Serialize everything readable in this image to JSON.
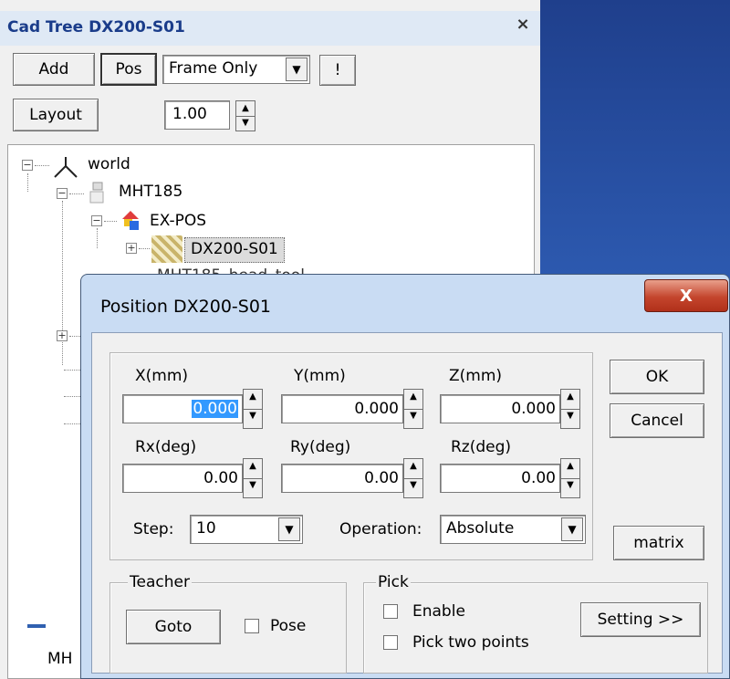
{
  "cad_tree": {
    "title": "Cad Tree DX200-S01",
    "close_glyph": "×",
    "add_label": "Add",
    "pos_label": "Pos",
    "frame_select_value": "Frame Only",
    "bang_label": "!",
    "layout_label": "Layout",
    "scale_value": "1.00",
    "nodes": {
      "world": "world",
      "mht185": "MHT185",
      "expos": "EX-POS",
      "dx200": "DX200-S01",
      "partial_sibling": "MHT185_head_tool",
      "bottom_label": "MH"
    }
  },
  "dialog": {
    "title": "Position DX200-S01",
    "close_glyph": "X",
    "fields": {
      "x_label": "X(mm)",
      "x_value": "0.000",
      "y_label": "Y(mm)",
      "y_value": "0.000",
      "z_label": "Z(mm)",
      "z_value": "0.000",
      "rx_label": "Rx(deg)",
      "rx_value": "0.00",
      "ry_label": "Ry(deg)",
      "ry_value": "0.00",
      "rz_label": "Rz(deg)",
      "rz_value": "0.00"
    },
    "step_label": "Step:",
    "step_value": "10",
    "operation_label": "Operation:",
    "operation_value": "Absolute",
    "ok_label": "OK",
    "cancel_label": "Cancel",
    "matrix_label": "matrix",
    "teacher": {
      "group_label": "Teacher",
      "goto_label": "Goto",
      "pose_label": "Pose"
    },
    "pick": {
      "group_label": "Pick",
      "enable_label": "Enable",
      "two_points_label": "Pick two points",
      "setting_label": "Setting >>"
    }
  },
  "colors": {
    "accent_blue": "#1a3c8a",
    "desktop_blue": "#2e5cb3",
    "close_red": "#c4452d",
    "selection": "#3399ff"
  }
}
